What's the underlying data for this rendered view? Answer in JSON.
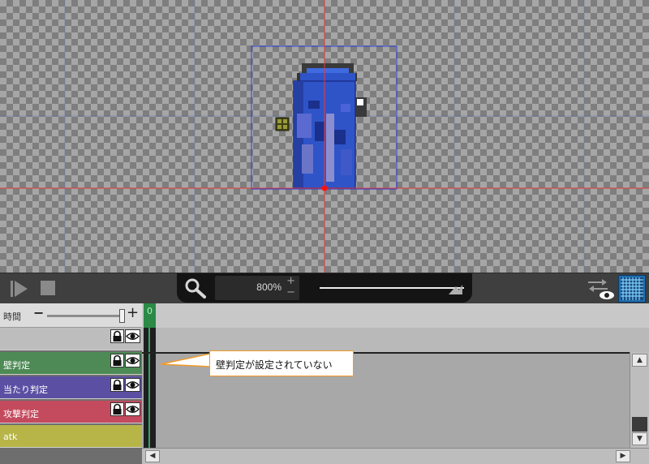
{
  "canvas": {
    "guide_color": "#e53b3b",
    "bounds_color": "#2d3fd6",
    "sprite_colors": [
      "#2f54c8",
      "#3f6ae0",
      "#1b2f8c",
      "#8b8fd0",
      "#2a2a2a",
      "#ffffff"
    ]
  },
  "toolbar": {
    "play_icon": "play-icon",
    "stop_icon": "stop-icon",
    "zoom_icon": "magnifier-icon",
    "zoom_value": "800%",
    "zoom_plus": "+",
    "zoom_minus": "−",
    "swap_icon": "swap-visibility-icon",
    "grid_icon": "grid-icon"
  },
  "layer_panel": {
    "time_label": "時間",
    "time_minus": "−",
    "time_plus": "+",
    "layers": [
      {
        "label": "",
        "color": "#bdbdbd",
        "faded": true
      },
      {
        "label": "壁判定",
        "color": "#4d8a55"
      },
      {
        "label": "当たり判定",
        "color": "#5b4fa3"
      },
      {
        "label": "攻撃判定",
        "color": "#c44a5d"
      },
      {
        "label": "atk",
        "color": "#b7b548"
      }
    ]
  },
  "timeline": {
    "current_frame": "0",
    "accent_color": "#2a8a46"
  },
  "scrollbars": {
    "up": "▲",
    "down": "▼",
    "left": "◀",
    "right": "▶"
  },
  "callout": {
    "text": "壁判定が設定されていない",
    "border_color": "#f29a2a"
  }
}
